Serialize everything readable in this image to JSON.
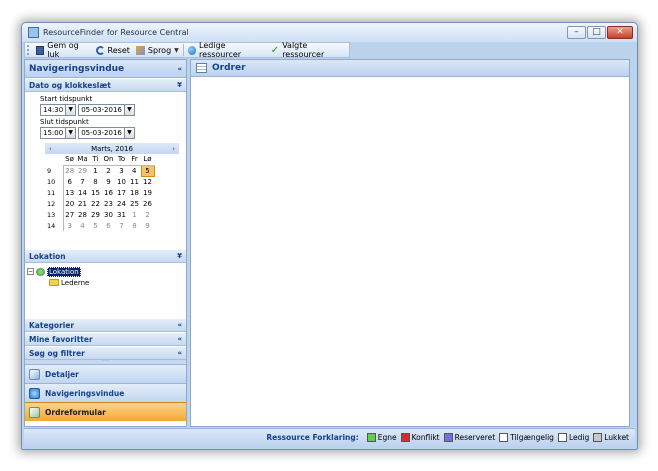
{
  "window": {
    "title": "ResourceFinder for Resource Central"
  },
  "toolbar": {
    "save_close": "Gem og luk",
    "reset": "Reset",
    "language": "Sprog",
    "available": "Ledige ressourcer",
    "selected": "Valgte ressourcer"
  },
  "nav": {
    "title": "Navigeringsvindue",
    "datetime": {
      "title": "Dato og klokkeslæt",
      "start_label": "Start tidspunkt",
      "start_time": "14:30",
      "start_date": "05-03-2016",
      "end_label": "Slut tidspunkt",
      "end_time": "15:00",
      "end_date": "05-03-2016"
    },
    "calendar": {
      "month": "Marts, 2016",
      "prev": "‹",
      "next": "›",
      "days": [
        "Sø",
        "Ma",
        "Ti",
        "On",
        "To",
        "Fr",
        "Lø"
      ],
      "weeks": [
        {
          "wk": "9",
          "d": [
            "28",
            "29",
            "1",
            "2",
            "3",
            "4",
            "5"
          ]
        },
        {
          "wk": "10",
          "d": [
            "6",
            "7",
            "8",
            "9",
            "10",
            "11",
            "12"
          ]
        },
        {
          "wk": "11",
          "d": [
            "13",
            "14",
            "15",
            "16",
            "17",
            "18",
            "19"
          ]
        },
        {
          "wk": "12",
          "d": [
            "20",
            "21",
            "22",
            "23",
            "24",
            "25",
            "26"
          ]
        },
        {
          "wk": "13",
          "d": [
            "27",
            "28",
            "29",
            "30",
            "31",
            "1",
            "2"
          ]
        },
        {
          "wk": "14",
          "d": [
            "3",
            "4",
            "5",
            "6",
            "7",
            "8",
            "9"
          ]
        }
      ]
    },
    "location": {
      "title": "Lokation",
      "root": "Lokation",
      "child": "Lederne"
    },
    "categories": "Kategorier",
    "favorites": "Mine favoritter",
    "search": "Søg og filtrer",
    "buttons": {
      "details": "Detaljer",
      "navigation": "Navigeringsvindue",
      "order_form": "Ordreformular"
    }
  },
  "main": {
    "title": "Ordrer"
  },
  "legend": {
    "title": "Ressource Forklaring:",
    "items": [
      {
        "label": "Egne",
        "color": "#5ecf4b"
      },
      {
        "label": "Konflikt",
        "color": "#d92b2b"
      },
      {
        "label": "Reserveret",
        "color": "#6f73e0"
      },
      {
        "label": "Tilgængelig",
        "color": "#ffffff"
      },
      {
        "label": "Ledig",
        "color": "#ffffff"
      },
      {
        "label": "Lukket",
        "color": "#c8c8c8"
      }
    ]
  }
}
